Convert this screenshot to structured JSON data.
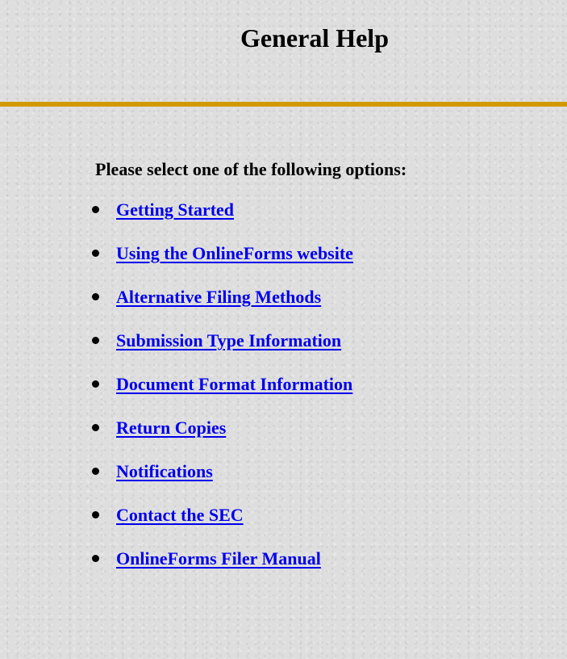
{
  "page": {
    "title": "General Help",
    "prompt": "Please select one of the following options:"
  },
  "options": [
    {
      "label": "Getting Started"
    },
    {
      "label": "Using the OnlineForms website"
    },
    {
      "label": "Alternative Filing Methods"
    },
    {
      "label": "Submission Type Information"
    },
    {
      "label": "Document Format Information"
    },
    {
      "label": "Return Copies"
    },
    {
      "label": "Notifications"
    },
    {
      "label": "Contact the SEC"
    },
    {
      "label": "OnlineForms Filer Manual"
    }
  ],
  "colors": {
    "background": "#dedede",
    "divider": "#d19a00",
    "link": "#0000ee",
    "text": "#000000"
  }
}
